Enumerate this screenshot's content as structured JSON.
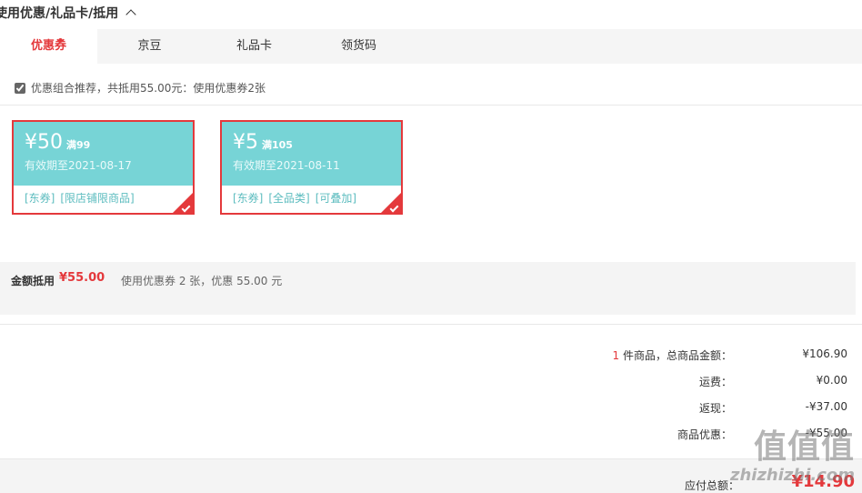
{
  "section": {
    "title": "使用优惠/礼品卡/抵用"
  },
  "tabs": [
    {
      "label": "优惠券",
      "active": true
    },
    {
      "label": "京豆"
    },
    {
      "label": "礼品卡"
    },
    {
      "label": "领货码"
    }
  ],
  "recommend": {
    "text": "优惠组合推荐，共抵用55.00元：使用优惠券2张"
  },
  "coupons": [
    {
      "amount": "¥50",
      "condition": "满99",
      "valid": "有效期至2021-08-17",
      "tags": [
        "[东券]",
        "[限店铺限商品]"
      ]
    },
    {
      "amount": "¥5",
      "condition": "满105",
      "valid": "有效期至2021-08-11",
      "tags": [
        "[东券]",
        "[全品类]",
        "[可叠加]"
      ]
    }
  ],
  "summary": {
    "label": "金额抵用",
    "value": "¥55.00",
    "desc": "使用优惠券 2 张，优惠 55.00 元"
  },
  "totals": {
    "items_count": "1",
    "items_label": " 件商品，总商品金额：",
    "items_value": "¥106.90",
    "shipping_label": "运费：",
    "shipping_value": "¥0.00",
    "cashback_label": "返现：",
    "cashback_value": "-¥37.00",
    "discount_label": "商品优惠：",
    "discount_value": "-¥55.00",
    "payable_label": "应付总额：",
    "payable_value": "¥14.90"
  },
  "watermark": {
    "logo": "值值值",
    "site": "zhizhizhi.com"
  },
  "colors": {
    "accent": "#e4393c",
    "coupon_bg": "#77d4d6"
  }
}
